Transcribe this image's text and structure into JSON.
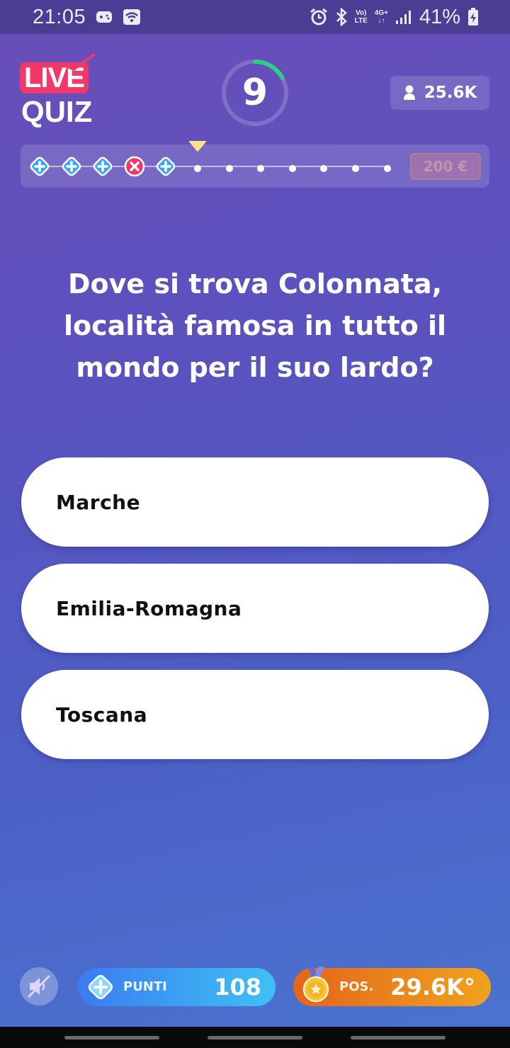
{
  "status_bar": {
    "time": "21:05",
    "network_top": "Vo)",
    "network_bottom": "LTE",
    "net_type": "4G+",
    "battery": "41%",
    "icons": [
      "gamepad-icon",
      "wifi-icon",
      "alarm-icon",
      "bluetooth-icon",
      "signal-icon",
      "battery-charging-icon"
    ]
  },
  "header": {
    "logo_top": "LIVE",
    "logo_bottom": "QUIZ",
    "timer_value": "9",
    "timer_fraction_remaining": 0.17,
    "viewers": "25.6K"
  },
  "progress": {
    "steps": [
      "plus",
      "plus",
      "plus",
      "wrong",
      "plus",
      "dot",
      "dot",
      "dot",
      "dot",
      "dot",
      "dot",
      "dot"
    ],
    "current_step_index": 5,
    "prize": "200 €"
  },
  "question": {
    "text": "Dove si trova Colonnata, località famosa in tutto il mondo per il suo lardo?"
  },
  "answers": [
    "Marche",
    "Emilia-Romagna",
    "Toscana"
  ],
  "footer": {
    "points_label": "PUNTI",
    "points_value": "108",
    "position_label": "POS.",
    "position_value": "29.6K°"
  },
  "colors": {
    "accent_pink": "#f0386b",
    "timer_green": "#2fcf83",
    "points_blue": "#3a7cf0",
    "position_orange": "#e3651b"
  }
}
